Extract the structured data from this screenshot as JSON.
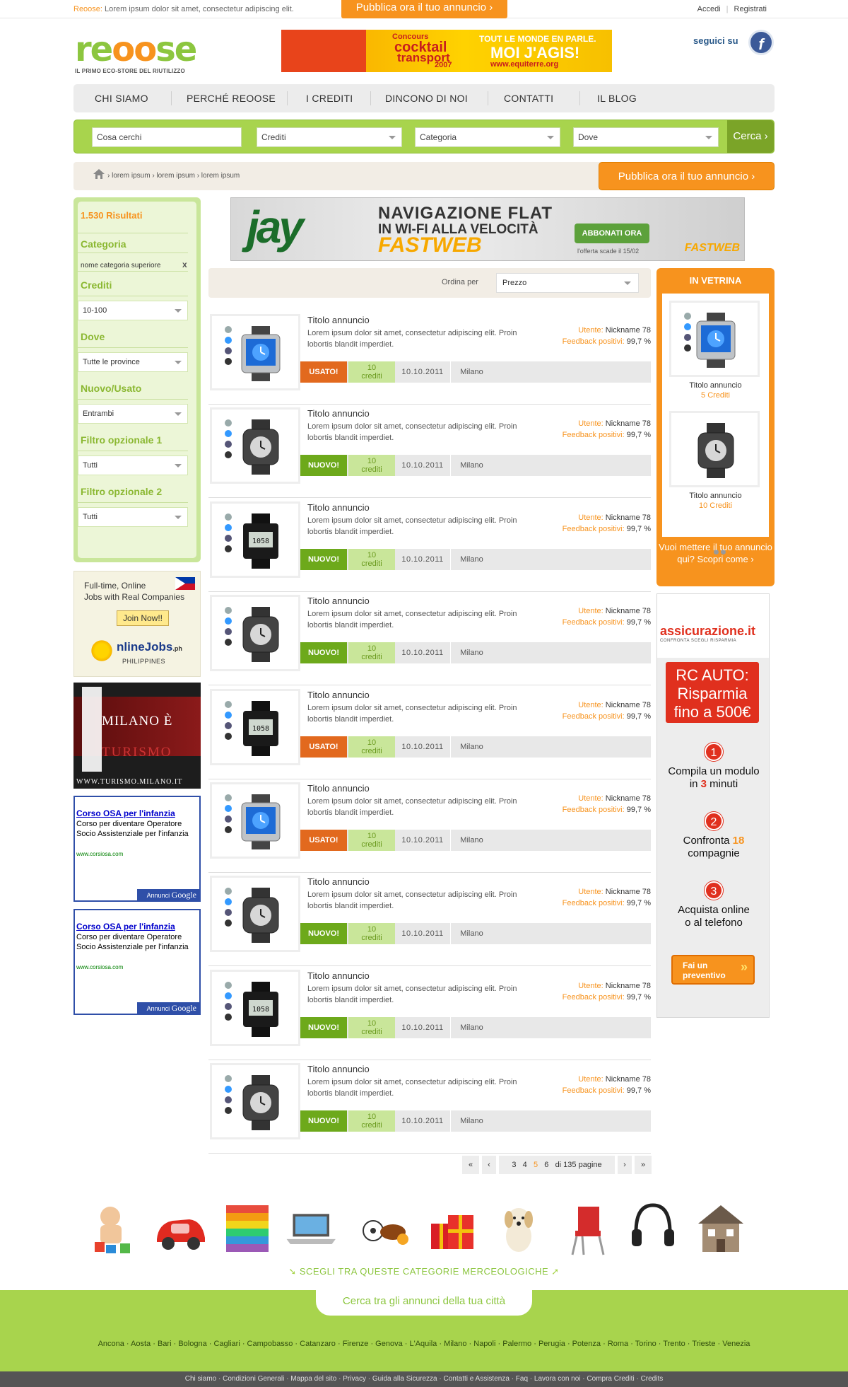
{
  "topbar": {
    "brand": "Reoose:",
    "tagline": "Lorem ipsum dolor sit amet, consectetur adipiscing elit.",
    "publish_cta": "Pubblica ora il tuo annuncio ›",
    "login": "Accedi",
    "register": "Registrati"
  },
  "logo": {
    "name_a": "re",
    "name_b": "oo",
    "name_c": "se",
    "tagline": "IL PRIMO ECO-STORE DEL RIUTILIZZO"
  },
  "top_banner": {
    "l1": "Concours",
    "l2": "cocktail",
    "l3": "transport",
    "l4": "2007",
    "l5": "TOUT LE MONDE EN PARLE.",
    "l6": "MOI J'AGIS!",
    "l7": "www.equiterre.org"
  },
  "social": {
    "follow": "seguici su",
    "icon": "facebook-icon",
    "letter": "f"
  },
  "nav": [
    "CHI SIAMO",
    "PERCHÉ REOOSE",
    "I CREDITI",
    "DINCONO DI NOI",
    "CONTATTI",
    "IL BLOG"
  ],
  "search": {
    "query_placeholder": "Cosa cerchi",
    "credits": "Crediti",
    "category": "Categoria",
    "where": "Dove",
    "button": "Cerca ›"
  },
  "breadcrumb": {
    "items": "› lorem ipsum › lorem ipsum › lorem ipsum",
    "publish": "Pubblica ora il tuo annuncio ›"
  },
  "filters": {
    "results": "1.530 Risultati",
    "category_head": "Categoria",
    "category_value": "nome categoria superiore",
    "remove": "x",
    "credits_head": "Crediti",
    "credits_value": "10-100",
    "where_head": "Dove",
    "where_value": "Tutte le province",
    "condition_head": "Nuovo/Usato",
    "condition_value": "Entrambi",
    "opt1_head": "Filtro opzionale 1",
    "opt1_value": "Tutti",
    "opt2_head": "Filtro opzionale 2",
    "opt2_value": "Tutti"
  },
  "ad_jobs": {
    "line1": "Full-time, Online",
    "line2": "Jobs with Real Companies",
    "button": "Join Now!!",
    "brand": "nlineJobs",
    "brand_tld": ".ph",
    "country": "PHILIPPINES"
  },
  "ad_milano": {
    "line1": "MILANO È",
    "line2": "TURISMO",
    "url": "WWW.TURISMO.MILANO.IT"
  },
  "google_ads": [
    {
      "title": "Corso OSA per l'infanzia",
      "body": "Corso per diventare Operatore Socio Assistenziale per l'infanzia",
      "url": "www.corsiosa.com",
      "foot_a": "Annunci ",
      "foot_b": "Google"
    },
    {
      "title": "Corso OSA per l'infanzia",
      "body": "Corso per diventare Operatore Socio Assistenziale per l'infanzia",
      "url": "www.corsiosa.com",
      "foot_a": "Annunci ",
      "foot_b": "Google"
    }
  ],
  "main_ad": {
    "brand": "jay",
    "l1": "NAVIGAZIONE FLAT",
    "l2": "IN WI-FI ALLA VELOCITÀ",
    "l3": "FASTWEB",
    "button": "ABBONATI ORA",
    "note": "l'offerta scade il 15/02",
    "logo": "FASTWEB"
  },
  "sort": {
    "label": "Ordina per",
    "value": "Prezzo"
  },
  "listing_labels": {
    "title": "Titolo annuncio",
    "desc": "Lorem ipsum dolor sit amet, consectetur adipiscing elit. Proin lobortis blandit imperdiet.",
    "user_key": "Utente:",
    "user_value": "Nickname 78",
    "feedback_key": "Feedback positivi:",
    "feedback_value": "99,7 %",
    "credits_word": "crediti"
  },
  "listings": [
    {
      "badge": "USATO!",
      "kind": "used",
      "credits": "10",
      "date": "10.10.2011",
      "city": "Milano",
      "img": "silver"
    },
    {
      "badge": "NUOVO!",
      "kind": "new",
      "credits": "10",
      "date": "10.10.2011",
      "city": "Milano",
      "img": "dark"
    },
    {
      "badge": "NUOVO!",
      "kind": "new",
      "credits": "10",
      "date": "10.10.2011",
      "city": "Milano",
      "img": "black"
    },
    {
      "badge": "NUOVO!",
      "kind": "new",
      "credits": "10",
      "date": "10.10.2011",
      "city": "Milano",
      "img": "dark"
    },
    {
      "badge": "USATO!",
      "kind": "used",
      "credits": "10",
      "date": "10.10.2011",
      "city": "Milano",
      "img": "black"
    },
    {
      "badge": "USATO!",
      "kind": "used",
      "credits": "10",
      "date": "10.10.2011",
      "city": "Milano",
      "img": "silver"
    },
    {
      "badge": "NUOVO!",
      "kind": "new",
      "credits": "10",
      "date": "10.10.2011",
      "city": "Milano",
      "img": "dark"
    },
    {
      "badge": "NUOVO!",
      "kind": "new",
      "credits": "10",
      "date": "10.10.2011",
      "city": "Milano",
      "img": "black"
    },
    {
      "badge": "NUOVO!",
      "kind": "new",
      "credits": "10",
      "date": "10.10.2011",
      "city": "Milano",
      "img": "dark"
    }
  ],
  "pager": {
    "first": "«",
    "prev": "‹",
    "pages": [
      "3",
      "4",
      "5",
      "6"
    ],
    "current": "5",
    "of": "di 135 pagine",
    "next": "›",
    "last": "»"
  },
  "vetrina": {
    "head": "IN VETRINA",
    "items": [
      {
        "title": "Titolo annuncio",
        "credits": "5 Crediti",
        "img": "silver"
      },
      {
        "title": "Titolo annuncio",
        "credits": "10 Crediti",
        "img": "dark"
      }
    ],
    "foot": "Vuoi mettere il tuo annuncio qui? Scopri come ›"
  },
  "ad_assic": {
    "logo": "assicurazione.it",
    "logo_sub": "CONFRONTA SCEGLI RISPARMIA",
    "rc1": "RC AUTO:",
    "rc2": "Risparmia",
    "rc3": "fino a 500€",
    "s1a": "Compila un modulo",
    "s1b": "in ",
    "s1c": "3",
    "s1d": " minuti",
    "s2a": "Confronta ",
    "s2b": "18",
    "s2c": "compagnie",
    "s3a": "Acquista online",
    "s3b": "o al telefono",
    "button_a": "Fai un",
    "button_b": "preventivo"
  },
  "categories": {
    "icons": [
      "baby-toys-icon",
      "toy-car-icon",
      "clothes-icon",
      "laptop-icon",
      "sport-balls-icon",
      "gifts-icon",
      "puppy-icon",
      "chair-icon",
      "headphones-icon",
      "house-icon"
    ],
    "title": "SCEGLI TRA QUESTE CATEGORIE MERCEOLOGICHE"
  },
  "footer": {
    "city_tab": "Cerca tra gli annunci della tua città",
    "cities": [
      "Ancona",
      "Aosta",
      "Bari",
      "Bologna",
      "Cagliari",
      "Campobasso",
      "Catanzaro",
      "Firenze",
      "Genova",
      "L'Aquila",
      "Milano",
      "Napoli",
      "Palermo",
      "Perugia",
      "Potenza",
      "Roma",
      "Torino",
      "Trento",
      "Trieste",
      "Venezia"
    ],
    "links": [
      "Chi siamo",
      "Condizioni Generali",
      "Mappa del sito",
      "Privacy",
      "Guida alla Sicurezza",
      "Contatti e Assistenza",
      "Faq",
      "Lavora con noi",
      "Compra Crediti",
      "Credits"
    ]
  },
  "colors": {
    "green": "#8cc63f",
    "orange": "#f7931e",
    "new_badge": "#6da91b",
    "used_badge": "#e2691e"
  }
}
